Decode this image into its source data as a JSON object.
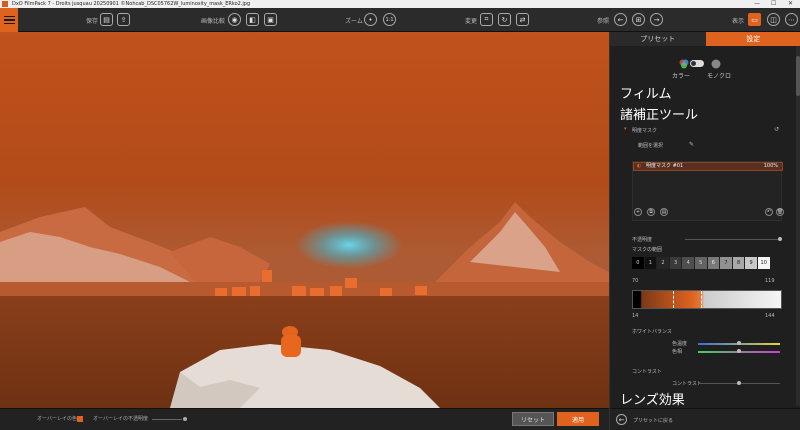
{
  "window": {
    "title": "DxO FilmPack 7 - Droits jusquau 20250901 ©Nohcab_DSC05762W_luminosity_mask_ERko2.jpg",
    "controls": [
      "—",
      "☐",
      "✕"
    ]
  },
  "toolbar": {
    "save_label": "保存",
    "compare_label": "画像比較",
    "zoom_label": "ズーム",
    "zoom_value": "1:1",
    "change_label": "変更",
    "reference_label": "参照",
    "display_label": "表示"
  },
  "status": {
    "overlay_color_label": "オーバーレイの色",
    "overlay_opacity_label": "オーバーレイの不透明度",
    "overlay_color": "#e0621f",
    "reset_label": "リセット",
    "apply_label": "適用"
  },
  "panel": {
    "tabs": [
      {
        "label": "プリセット",
        "active": false
      },
      {
        "label": "設定",
        "active": true
      }
    ],
    "mode_color_label": "カラー",
    "mode_mono_label": "モノクロ",
    "film_heading": "フィルム",
    "tools_heading": "諸補正ツール",
    "mask_section_label": "明度マスク",
    "range_select_label": "範囲を選択",
    "mask_item": {
      "name": "明度マスク #01",
      "value": "100%"
    },
    "opacity_label": "不透明度",
    "mask_range_label": "マスクの範囲",
    "zone_cells": [
      "0",
      "1",
      "2",
      "3",
      "4",
      "5",
      "6",
      "7",
      "8",
      "9",
      "10"
    ],
    "range_low": "70",
    "range_high": "119",
    "feather_low": "14",
    "feather_high": "144",
    "white_balance_label": "ホワイトバランス",
    "temperature_label": "色温度",
    "tint_label": "色相",
    "contrast_section_label": "コントラスト",
    "contrast_label": "コントラスト",
    "lens_heading": "レンズ効果",
    "back_label": "プリセットに戻る"
  }
}
